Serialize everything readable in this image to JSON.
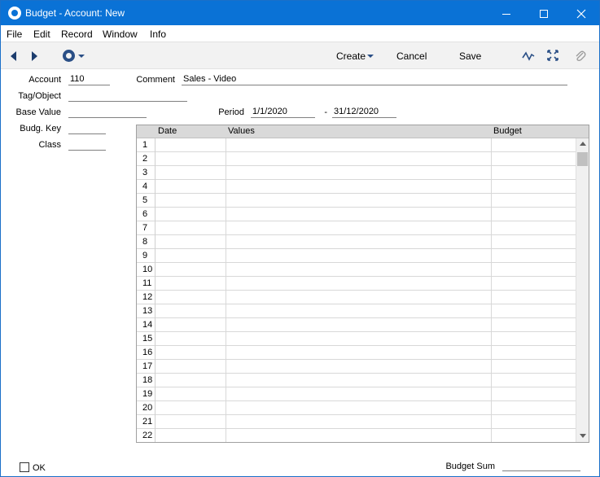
{
  "window": {
    "title": "Budget - Account: New"
  },
  "menu": {
    "items": [
      "File",
      "Edit",
      "Record",
      "Window",
      "Info"
    ]
  },
  "toolbar": {
    "create_label": "Create",
    "cancel_label": "Cancel",
    "save_label": "Save"
  },
  "form": {
    "account": {
      "label": "Account",
      "value": "110"
    },
    "comment": {
      "label": "Comment",
      "value": "Sales - Video"
    },
    "tag_object": {
      "label": "Tag/Object",
      "value": ""
    },
    "base_value": {
      "label": "Base Value",
      "value": ""
    },
    "period": {
      "label": "Period",
      "from": "1/1/2020",
      "separator": "-",
      "to": "31/12/2020"
    },
    "budg_key": {
      "label": "Budg. Key",
      "value": ""
    },
    "class": {
      "label": "Class",
      "value": ""
    }
  },
  "grid": {
    "columns": [
      "Date",
      "Values",
      "Budget"
    ],
    "row_numbers": [
      "1",
      "2",
      "3",
      "4",
      "5",
      "6",
      "7",
      "8",
      "9",
      "10",
      "11",
      "12",
      "13",
      "14",
      "15",
      "16",
      "17",
      "18",
      "19",
      "20",
      "21",
      "22"
    ]
  },
  "footer": {
    "ok_label": "OK",
    "budget_sum_label": "Budget Sum",
    "budget_sum_value": ""
  },
  "colors": {
    "titlebar": "#0a72d6",
    "toolbar_icon": "#2a4f86"
  }
}
